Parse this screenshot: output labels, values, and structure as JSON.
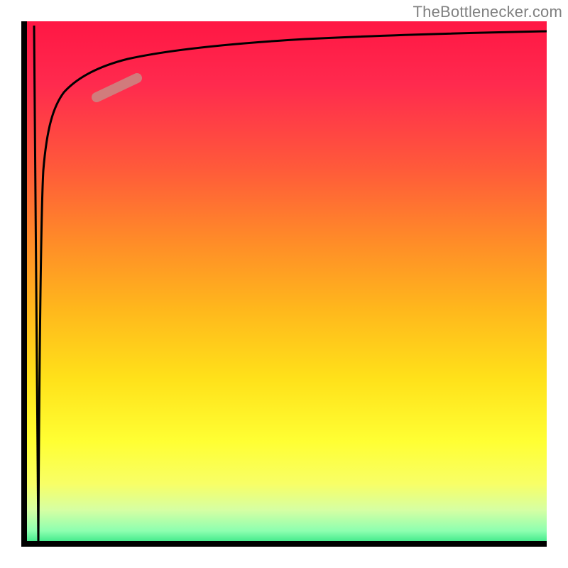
{
  "branding": {
    "watermark": "TheBottlenecker.com"
  },
  "chart_data": {
    "type": "line",
    "title": "",
    "xlabel": "",
    "ylabel": "",
    "xlim": [
      0,
      100
    ],
    "ylim": [
      0,
      100
    ],
    "grid": false,
    "legend": false,
    "series": [
      {
        "name": "bottleneck-curve",
        "x": [
          0.8,
          1.2,
          1.6,
          2.2,
          3.0,
          4.0,
          5.5,
          7.5,
          10.0,
          14.0,
          20.0,
          28.0,
          40.0,
          55.0,
          75.0,
          100.0
        ],
        "y": [
          0.0,
          60.0,
          72.0,
          78.0,
          82.0,
          85.0,
          87.5,
          89.5,
          91.0,
          92.3,
          93.5,
          94.5,
          95.5,
          96.2,
          96.8,
          97.3
        ]
      },
      {
        "name": "initial-drop",
        "x": [
          0.6,
          0.8
        ],
        "y": [
          99.0,
          0.0
        ]
      }
    ],
    "highlight": {
      "name": "highlight-segment",
      "color": "#c98a85",
      "x_range": [
        14.0,
        22.0
      ],
      "y_range": [
        85.5,
        89.0
      ]
    }
  }
}
